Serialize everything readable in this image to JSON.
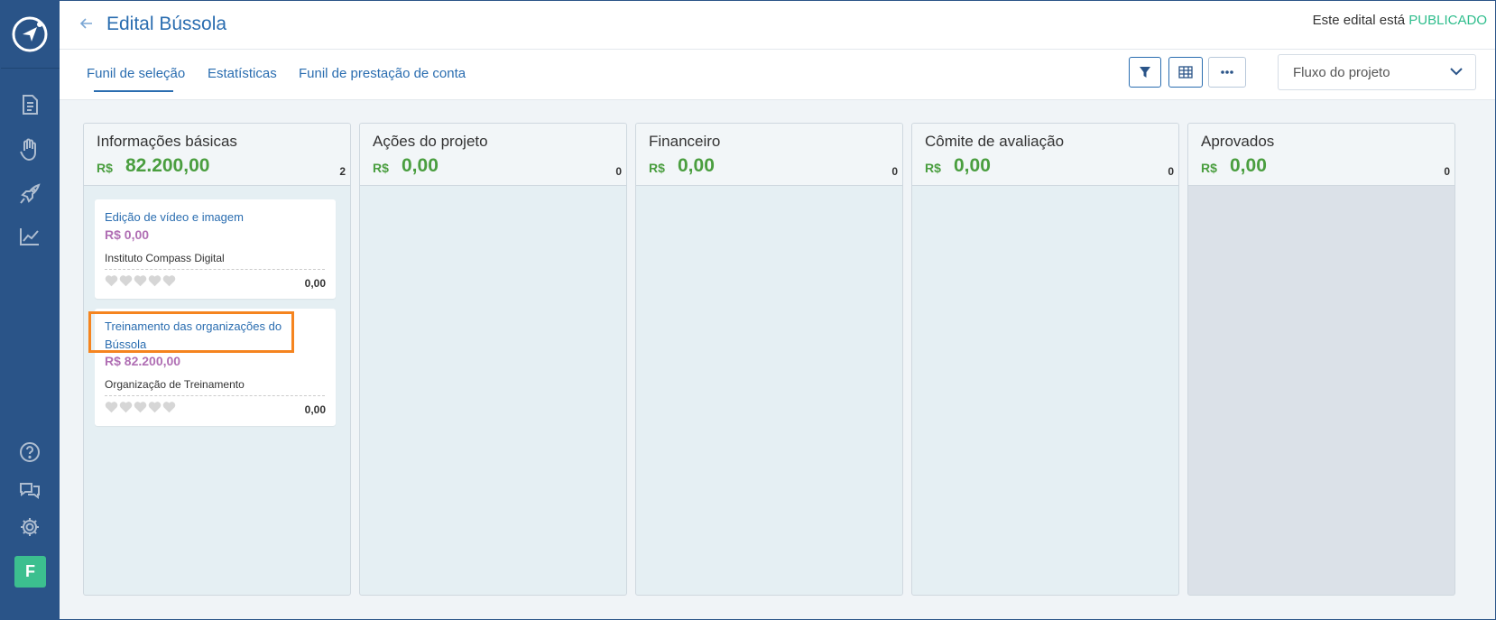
{
  "app": {
    "title": "Edital Bússola",
    "status_prefix": "Este edital está",
    "status_value": "PUBLICADO",
    "status_color": "#2ebd8c",
    "accent_color": "#2a6db0",
    "sidebar_color": "#2a5488"
  },
  "sidebar": {
    "logo_icon": "compass-logo",
    "top_icons": [
      "document-icon",
      "hand-heart-icon",
      "rocket-icon",
      "chart-trend-icon"
    ],
    "bottom_icons": [
      "help-icon",
      "chat-icon",
      "settings-icon"
    ],
    "avatar_letter": "F"
  },
  "tabs": [
    {
      "label": "Funil de seleção",
      "active": true
    },
    {
      "label": "Estatísticas",
      "active": false
    },
    {
      "label": "Funil de prestação de conta",
      "active": false
    }
  ],
  "toolbar": {
    "buttons": [
      "filter-icon",
      "table-icon",
      "more-icon"
    ],
    "flow_select_value": "Fluxo do projeto"
  },
  "columns": [
    {
      "title": "Informações básicas",
      "currency": "R$",
      "amount": "82.200,00",
      "count": "2",
      "cards": [
        {
          "title": "Edição de vídeo e imagem",
          "value": "R$  0,00",
          "org": "Instituto Compass Digital",
          "score": "0,00",
          "rating": 0
        },
        {
          "title": "Treinamento das organizações do Bússola",
          "value": "R$  82.200,00",
          "org": "Organização de Treinamento",
          "score": "0,00",
          "rating": 0,
          "highlighted": true
        }
      ]
    },
    {
      "title": "Ações do projeto",
      "currency": "R$",
      "amount": "0,00",
      "count": "0",
      "cards": []
    },
    {
      "title": "Financeiro",
      "currency": "R$",
      "amount": "0,00",
      "count": "0",
      "cards": []
    },
    {
      "title": "Cômite de avaliação",
      "currency": "R$",
      "amount": "0,00",
      "count": "0",
      "cards": []
    },
    {
      "title": "Aprovados",
      "currency": "R$",
      "amount": "0,00",
      "count": "0",
      "cards": []
    }
  ]
}
